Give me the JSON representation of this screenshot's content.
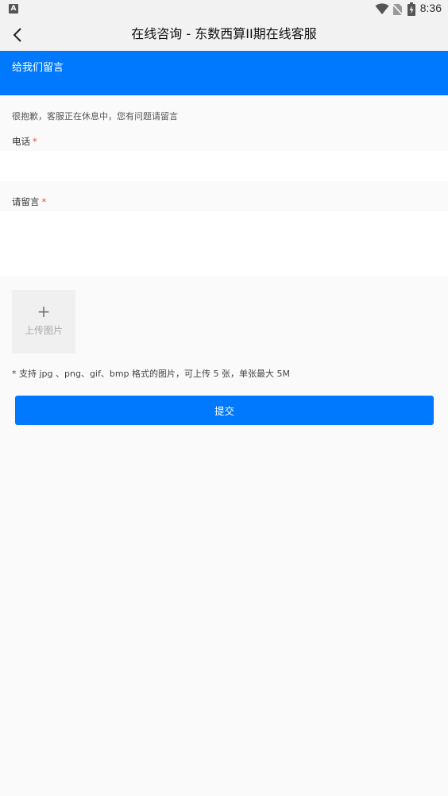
{
  "status_bar": {
    "app_icon_letter": "A",
    "time": "8:36"
  },
  "header": {
    "title": "在线咨询 - 东数西算II期在线客服"
  },
  "banner": {
    "title": "给我们留言"
  },
  "form": {
    "notice": "很抱歉，客服正在休息中，您有问题请留言",
    "phone_label": "电话",
    "message_label": "请留言",
    "required_mark": "*",
    "phone_value": "",
    "message_value": "",
    "upload_label": "上传图片",
    "upload_plus": "+",
    "upload_hint": "* 支持 jpg 、png、gif、bmp 格式的图片，可上传 5 张，单张最大 5M",
    "submit_label": "提交"
  },
  "icons": {
    "back": "chevron-left-icon",
    "wifi": "wifi-icon",
    "sim": "no-sim-icon",
    "battery": "battery-charging-icon"
  },
  "colors": {
    "accent": "#0079fe",
    "required": "#f5463f",
    "background": "#fafafa",
    "header_bg": "#f2f2f2"
  }
}
